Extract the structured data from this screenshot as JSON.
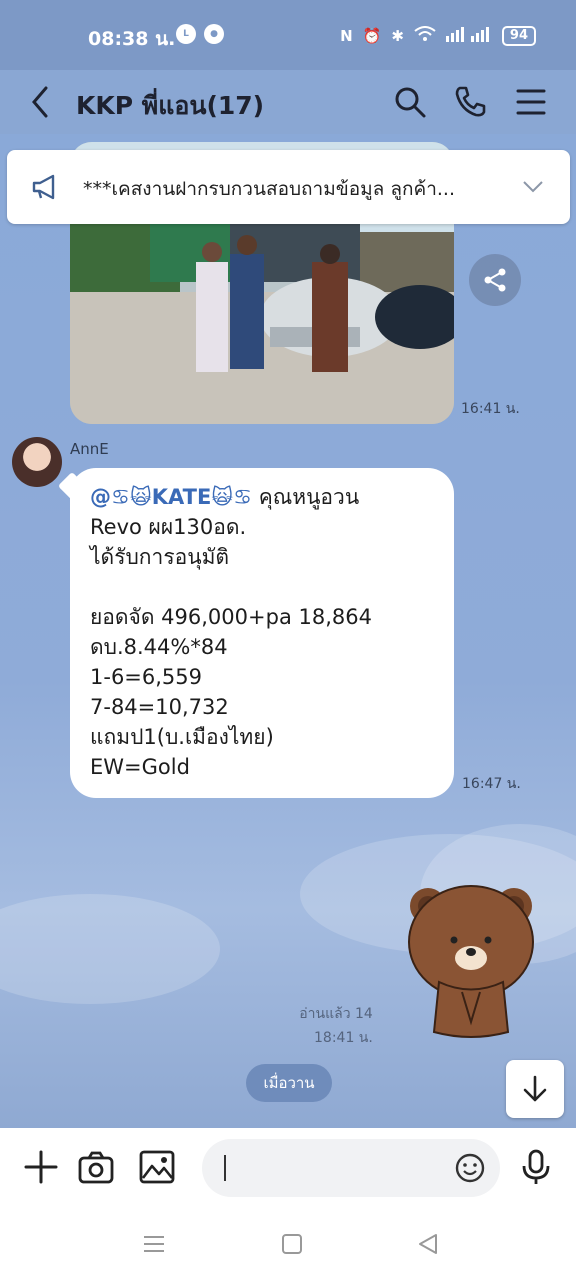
{
  "status": {
    "time": "08:38 น.",
    "battery": "94"
  },
  "header": {
    "title": "KKP พี่แอน(17)"
  },
  "pinned": {
    "text": "***เคสงานฝากรบกวนสอบถามข้อมูล ลูกค้า..."
  },
  "messages": {
    "photo_time": "16:41 น.",
    "sender": "AnnE",
    "mention": "@♋🙀KATE🙀♋",
    "text_lines": [
      "คุณหนูอวน",
      "Revo ผผ130อด.",
      "ได้รับการอนุมัติ",
      "",
      "ยอดจัด 496,000+pa 18,864",
      "ดบ.8.44%*84",
      "1-6=6,559",
      "7-84=10,732",
      "แถมป1(บ.เมืองไทย)",
      "EW=Gold"
    ],
    "text_time": "16:47 น.",
    "read_label": "อ่านแล้ว 14",
    "sticker_time": "18:41 น.",
    "date_chip": "เมื่อวาน"
  },
  "icons": {
    "back": "chevron-left-icon",
    "search": "search-icon",
    "call": "phone-icon",
    "menu": "menu-icon",
    "pin": "megaphone-icon",
    "share": "share-icon",
    "scroll_down": "arrow-down-icon",
    "add": "plus-icon",
    "camera": "camera-icon",
    "gallery": "image-icon",
    "emoji": "emoji-icon",
    "mic": "mic-icon"
  },
  "colors": {
    "chat_bg": "#8aa7d3",
    "mention": "#3a6ab7"
  }
}
